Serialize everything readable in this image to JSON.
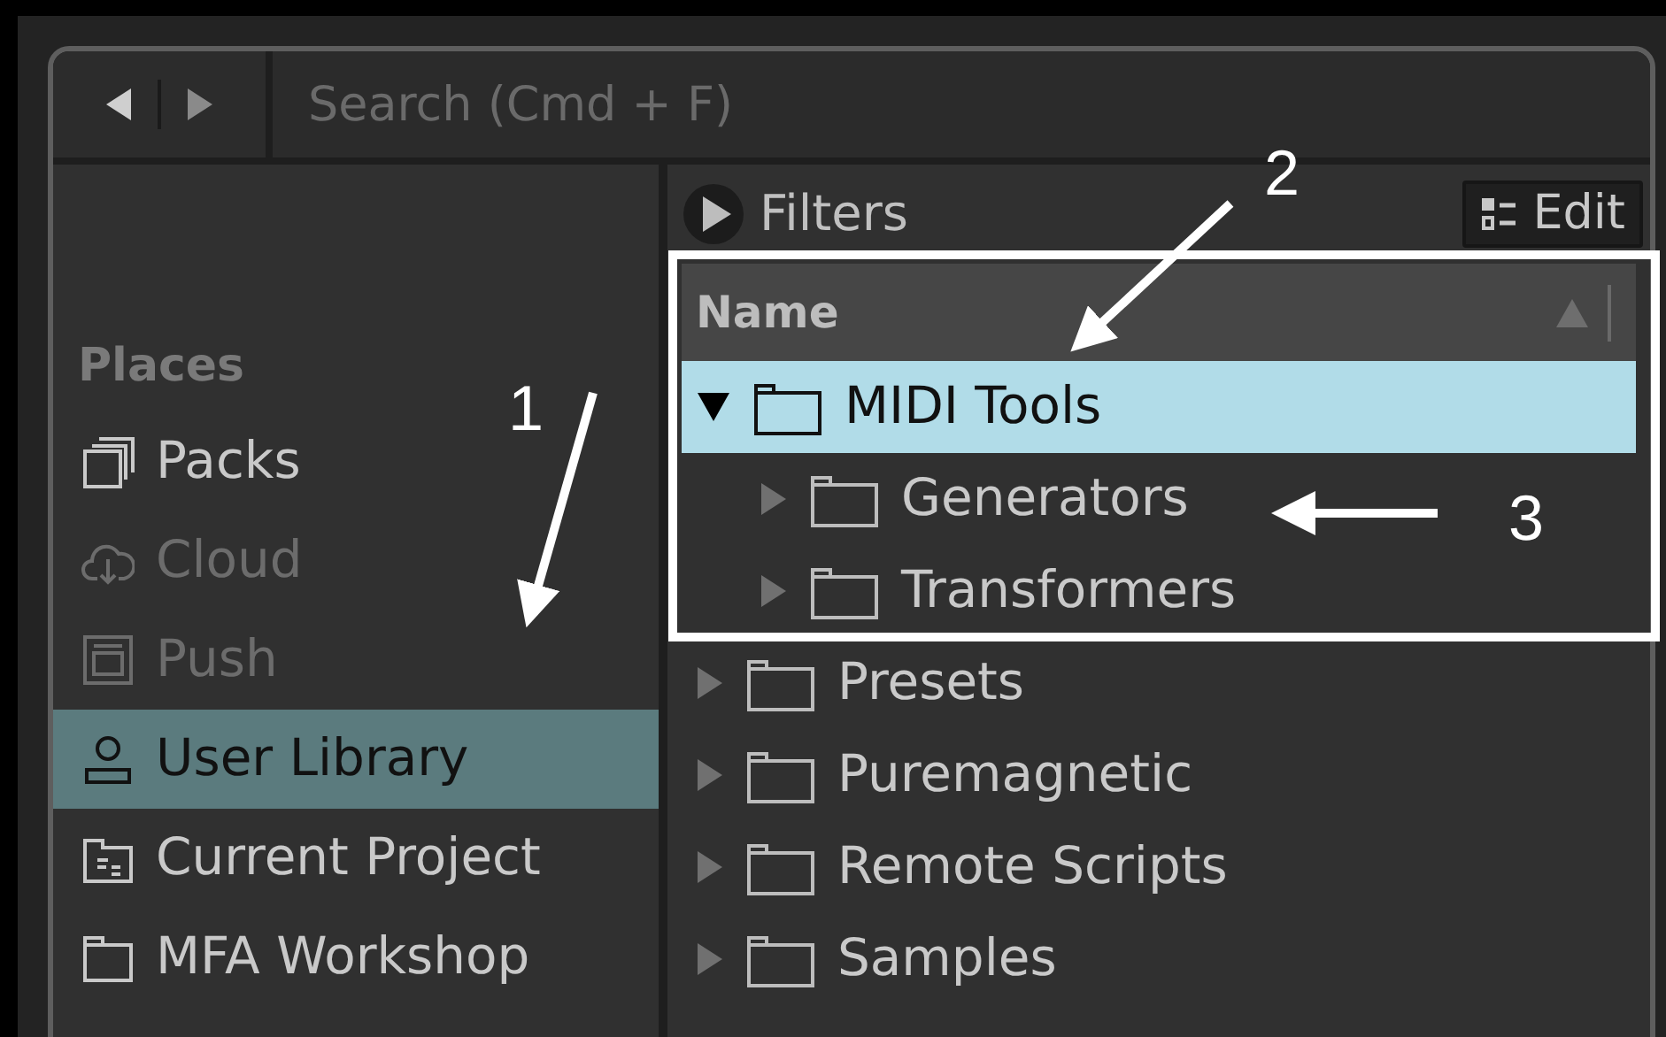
{
  "toolbar": {
    "search": {
      "placeholder": "Search (Cmd + F)"
    }
  },
  "sidebar": {
    "section": "Places",
    "items": [
      {
        "label": "Packs",
        "selected": false,
        "disabled": false
      },
      {
        "label": "Cloud",
        "selected": false,
        "disabled": true
      },
      {
        "label": "Push",
        "selected": false,
        "disabled": true
      },
      {
        "label": "User Library",
        "selected": true,
        "disabled": false
      },
      {
        "label": "Current Project",
        "selected": false,
        "disabled": false
      },
      {
        "label": "MFA Workshop",
        "selected": false,
        "disabled": false
      }
    ]
  },
  "browser": {
    "filters": "Filters",
    "edit_button": "Edit",
    "column": "Name",
    "tree": [
      {
        "label": "MIDI Tools",
        "expanded": true,
        "selected": true,
        "children": [
          {
            "label": "Generators",
            "expanded": false,
            "selected": false
          },
          {
            "label": "Transformers",
            "expanded": false,
            "selected": false
          }
        ]
      },
      {
        "label": "Presets",
        "expanded": false,
        "selected": false
      },
      {
        "label": "Puremagnetic",
        "expanded": false,
        "selected": false
      },
      {
        "label": "Remote Scripts",
        "expanded": false,
        "selected": false
      },
      {
        "label": "Samples",
        "expanded": false,
        "selected": false
      }
    ]
  },
  "annotations": [
    "1",
    "2",
    "3"
  ]
}
